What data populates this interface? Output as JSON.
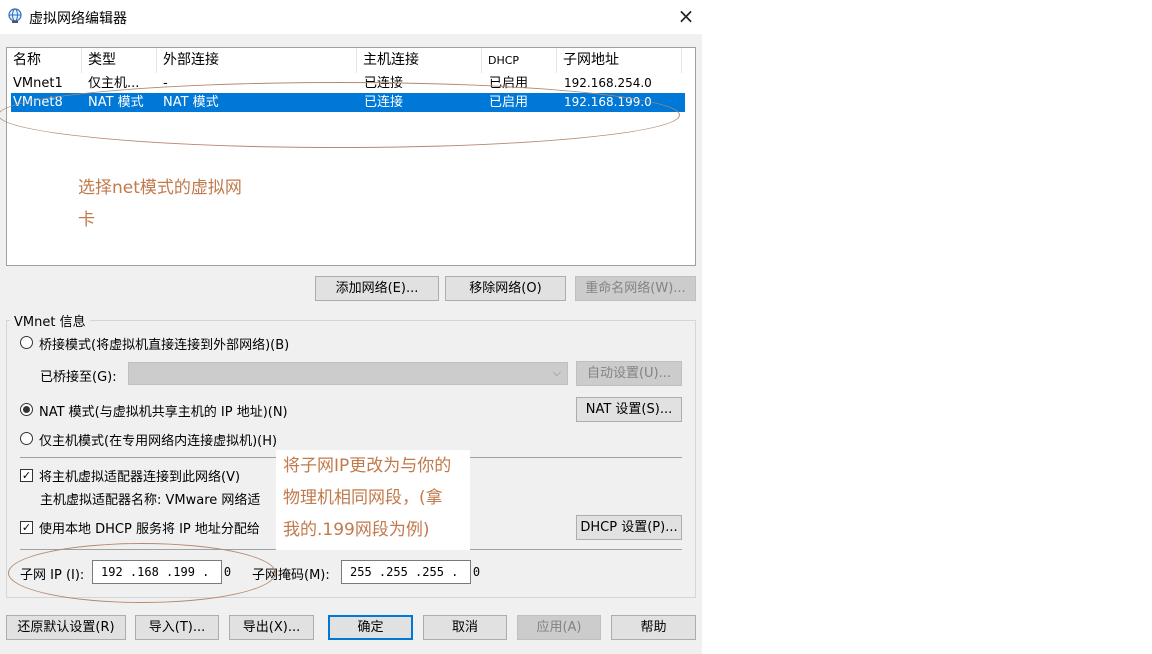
{
  "window": {
    "title": "虚拟网络编辑器",
    "icon": "network-globe-icon",
    "close": "×"
  },
  "list": {
    "columns": [
      "名称",
      "类型",
      "外部连接",
      "主机连接",
      "DHCP",
      "子网地址"
    ],
    "rows": [
      {
        "name": "VMnet1",
        "type": "仅主机...",
        "external": "-",
        "host": "已连接",
        "dhcp": "已启用",
        "subnet": "192.168.254.0"
      },
      {
        "name": "VMnet8",
        "type": "NAT 模式",
        "external": "NAT 模式",
        "host": "已连接",
        "dhcp": "已启用",
        "subnet": "192.168.199.0"
      }
    ]
  },
  "list_buttons": {
    "add": "添加网络(E)...",
    "remove": "移除网络(O)",
    "rename": "重命名网络(W)..."
  },
  "vmnet_info": {
    "group_label": "VMnet 信息",
    "bridge_mode": "桥接模式(将虚拟机直接连接到外部网络)(B)",
    "bridged_to": "已桥接至(G):",
    "auto_settings": "自动设置(U)...",
    "nat_mode": "NAT 模式(与虚拟机共享主机的 IP 地址)(N)",
    "nat_settings": "NAT 设置(S)...",
    "host_only": "仅主机模式(在专用网络内连接虚拟机)(H)",
    "connect_adapter": "将主机虚拟适配器连接到此网络(V)",
    "adapter_name": "主机虚拟适配器名称: VMware 网络适",
    "use_dhcp": "使用本地 DHCP 服务将 IP 地址分配给",
    "dhcp_settings": "DHCP 设置(P)...",
    "subnet_ip_label": "子网 IP (I):",
    "subnet_ip": "192 .168 .199 .  0",
    "subnet_mask_label": "子网掩码(M):",
    "subnet_mask": "255 .255 .255 .  0"
  },
  "bottom_buttons": {
    "restore": "还原默认设置(R)",
    "import": "导入(T)...",
    "export": "导出(X)...",
    "ok": "确定",
    "cancel": "取消",
    "apply": "应用(A)",
    "help": "帮助"
  },
  "annotations": {
    "select_line1": "选择net模式的虚拟网",
    "select_line2": "卡",
    "change_line1": "将子网IP更改为与你的",
    "change_line2": "物理机相同网段，(拿",
    "change_line3": "我的.199网段为例)"
  },
  "colors": {
    "selection": "#0078d7",
    "annotation": "#c17a4c",
    "oval": "#b48a6e"
  }
}
